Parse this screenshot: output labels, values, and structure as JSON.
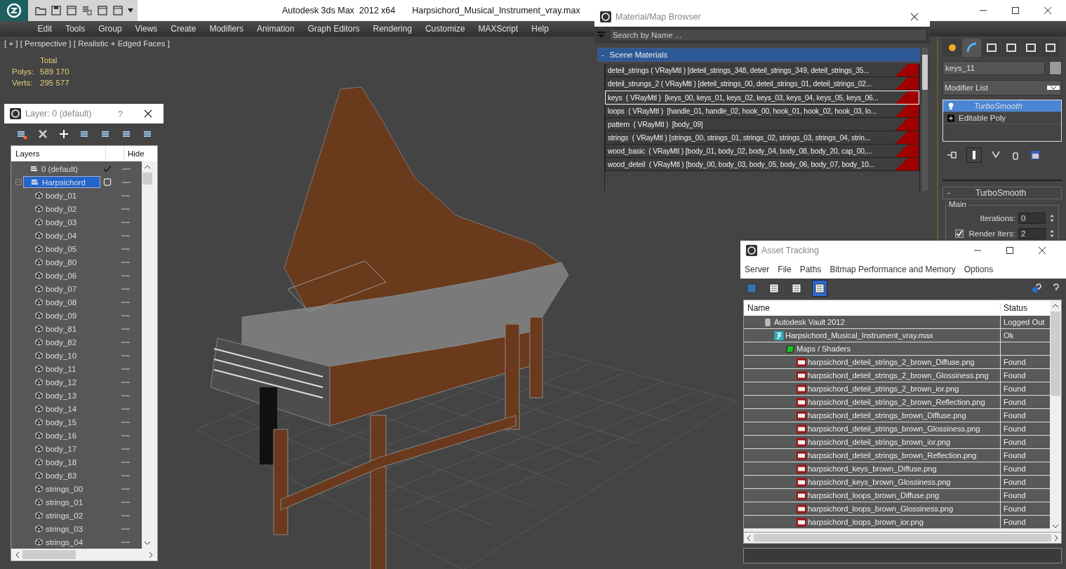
{
  "app": {
    "title": "Autodesk 3ds Max  2012 x64",
    "file": "Harpsichord_Musical_Instrument_vray.max"
  },
  "menu": [
    "Edit",
    "Tools",
    "Group",
    "Views",
    "Create",
    "Modifiers",
    "Animation",
    "Graph Editors",
    "Rendering",
    "Customize",
    "MAXScript",
    "Help"
  ],
  "viewport": {
    "label": "[ + ] [ Perspective ] [ Realistic + Edged Faces ]",
    "stats_heading": "Total",
    "stats": [
      {
        "label": "Polys:",
        "value": "589 170"
      },
      {
        "label": "Verts:",
        "value": "295 577"
      }
    ]
  },
  "layer_manager": {
    "title": "Layer: 0 (default)",
    "help": "?",
    "columns": [
      "Layers",
      "Hide"
    ],
    "layers": [
      {
        "name": "0 (default)",
        "current": true,
        "selected": false,
        "expanded": false
      },
      {
        "name": "Harpsichord",
        "current": false,
        "selected": true,
        "expanded": true,
        "children": [
          {
            "name": "body_01"
          },
          {
            "name": "body_02"
          },
          {
            "name": "body_03"
          },
          {
            "name": "body_04"
          },
          {
            "name": "body_05"
          },
          {
            "name": "body_80"
          },
          {
            "name": "body_06"
          },
          {
            "name": "body_07"
          },
          {
            "name": "body_08"
          },
          {
            "name": "body_09"
          },
          {
            "name": "body_81"
          },
          {
            "name": "body_82"
          },
          {
            "name": "body_10"
          },
          {
            "name": "body_11"
          },
          {
            "name": "body_12"
          },
          {
            "name": "body_13"
          },
          {
            "name": "body_14"
          },
          {
            "name": "body_15"
          },
          {
            "name": "body_16"
          },
          {
            "name": "body_17"
          },
          {
            "name": "body_18"
          },
          {
            "name": "body_83"
          },
          {
            "name": "strings_00"
          },
          {
            "name": "strings_01"
          },
          {
            "name": "strings_02"
          },
          {
            "name": "strings_03"
          },
          {
            "name": "strings_04"
          }
        ]
      }
    ]
  },
  "material_browser": {
    "title": "Material/Map Browser",
    "placeholder": "Search by Name ...",
    "group_toggle": "-",
    "group": "Scene Materials",
    "materials": [
      {
        "text": "deteil_strings ( VRayMtl ) [deteil_strings_348, deteil_strings_349, deteil_strings_35...",
        "selected": false
      },
      {
        "text": "deteil_strungs_2 ( VRayMtl ) [deteil_strings_00, deteil_strings_01, deteil_strings_02...",
        "selected": false
      },
      {
        "text": "keys  ( VRayMtl )  [keys_00, keys_01, keys_02, keys_03, keys_04, keys_05, keys_06...",
        "selected": true
      },
      {
        "text": "loops  ( VRayMtl )  [handle_01, handle_02, hook_00, hook_01, hook_02, hook_03, lo...",
        "selected": false
      },
      {
        "text": "pattern  ( VRayMtl )  [body_09]",
        "selected": false
      },
      {
        "text": "strings  ( VRayMtl ) [strings_00, strings_01, strings_02, strings_03, strings_04, strin...",
        "selected": false
      },
      {
        "text": "wood_basic  ( VRayMtl ) [body_01, body_02, body_04, body_08, body_20, cap_00,...",
        "selected": false
      },
      {
        "text": "wood_deteil  ( VRayMtl ) [body_00, body_03, body_05, body_06, body_07, body_10...",
        "selected": false
      }
    ]
  },
  "command_panel": {
    "tabs": [
      {
        "selected": false
      },
      {
        "selected": true
      },
      {
        "selected": false
      },
      {
        "selected": false
      },
      {
        "selected": false
      },
      {
        "selected": false
      }
    ],
    "object_name": "keys_11",
    "modifier_list": "Modifier List",
    "stack": [
      {
        "name": "TurboSmooth",
        "selected": true
      },
      {
        "name": "Editable Poly",
        "selected": false
      }
    ],
    "rollout": {
      "toggle": "-",
      "title": "TurboSmooth",
      "group": "Main",
      "iterations_label": "Iterations:",
      "iterations": "0",
      "render_iters_checked": true,
      "render_iters_label": "Render Iters:",
      "render_iters": "2"
    }
  },
  "asset_tracking": {
    "title": "Asset Tracking",
    "menu": [
      "Server",
      "File",
      "Paths",
      "Bitmap Performance and Memory",
      "Options"
    ],
    "toolbar": [
      {
        "selected": false
      },
      {
        "selected": false
      },
      {
        "selected": false
      },
      {
        "selected": true
      }
    ],
    "columns": [
      "Name",
      "Status"
    ],
    "rows": [
      {
        "kind": "server",
        "name": "Autodesk Vault 2012",
        "status": "Logged Out",
        "children": [
          {
            "kind": "scene",
            "name": "Harpsichord_Musical_Instrument_vray.max",
            "status": "Ok",
            "children": [
              {
                "kind": "folder",
                "name": "Maps / Shaders",
                "children": [
                  {
                    "kind": "png",
                    "name": "harpsichord_deteil_strings_2_brown_Diffuse.png",
                    "status": "Found"
                  },
                  {
                    "kind": "png",
                    "name": "harpsichord_deteil_strings_2_brown_Glossiness.png",
                    "status": "Found"
                  },
                  {
                    "kind": "png",
                    "name": "harpsichord_deteil_strings_2_brown_ior.png",
                    "status": "Found"
                  },
                  {
                    "kind": "png",
                    "name": "harpsichord_deteil_strings_2_brown_Reflection.png",
                    "status": "Found"
                  },
                  {
                    "kind": "png",
                    "name": "harpsichord_deteil_strings_brown_Diffuse.png",
                    "status": "Found"
                  },
                  {
                    "kind": "png",
                    "name": "harpsichord_deteil_strings_brown_Glossiness.png",
                    "status": "Found"
                  },
                  {
                    "kind": "png",
                    "name": "harpsichord_deteil_strings_brown_ior.png",
                    "status": "Found"
                  },
                  {
                    "kind": "png",
                    "name": "harpsichord_deteil_strings_brown_Reflection.png",
                    "status": "Found"
                  },
                  {
                    "kind": "png",
                    "name": "harpsichord_keys_brown_Diffuse.png",
                    "status": "Found"
                  },
                  {
                    "kind": "png",
                    "name": "harpsichord_keys_brown_Glossiness.png",
                    "status": "Found"
                  },
                  {
                    "kind": "png",
                    "name": "harpsichord_loops_brown_Diffuse.png",
                    "status": "Found"
                  },
                  {
                    "kind": "png",
                    "name": "harpsichord_loops_brown_Glossiness.png",
                    "status": "Found"
                  },
                  {
                    "kind": "png",
                    "name": "harpsichord_loops_brown_ior.png",
                    "status": "Found"
                  }
                ]
              }
            ]
          }
        ]
      }
    ]
  }
}
